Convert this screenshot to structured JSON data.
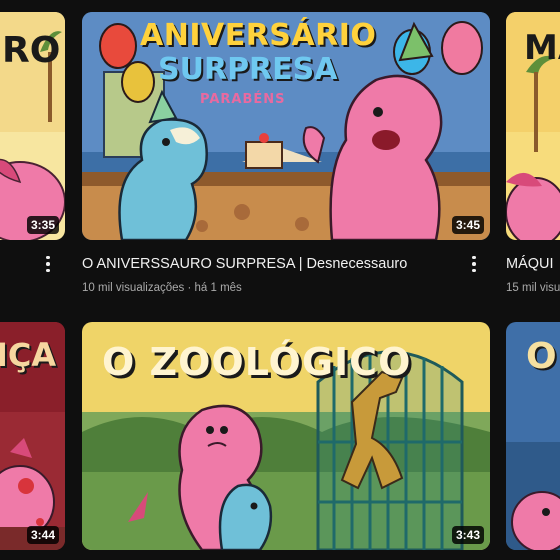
{
  "videos": [
    {
      "id": "top-left",
      "thumb_text": "RO",
      "duration": "3:35"
    },
    {
      "id": "top-center",
      "thumb_text_line1": "ANIVERSÁRIO",
      "thumb_text_line2": "SURPRESA",
      "banner_text": "PARABÉNS",
      "duration": "3:45",
      "title": "O ANIVERSSAURO SURPRESA | Desnecessauro",
      "views": "10 mil visualizações",
      "age": "há 1 mês"
    },
    {
      "id": "top-right",
      "thumb_text": "MÁ",
      "title": "MÁQUI",
      "views": "15 mil visu"
    },
    {
      "id": "bottom-left",
      "thumb_text": "IÇA",
      "duration": "3:44"
    },
    {
      "id": "bottom-center",
      "thumb_text": "O ZOOLÓGICO",
      "duration": "3:43"
    },
    {
      "id": "bottom-right",
      "thumb_text": "O"
    }
  ],
  "separator": " · ",
  "colors": {
    "background": "#0f0f0f",
    "title": "#f1f1f1",
    "meta": "#aaaaaa",
    "dino_pink": "#ef7aa8",
    "dino_blue": "#6fc0d8"
  },
  "icons": {
    "more": "more-vert-icon"
  }
}
